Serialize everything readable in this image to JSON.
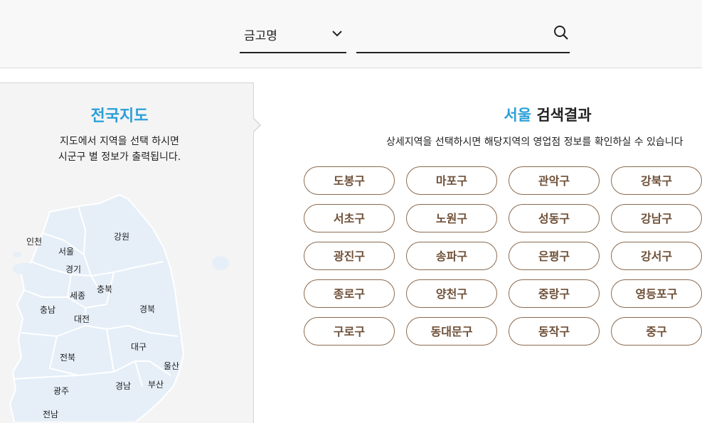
{
  "search": {
    "select_value": "금고명",
    "input_value": "",
    "input_placeholder": ""
  },
  "map_panel": {
    "title": "전국지도",
    "desc_line1": "지도에서 지역을 선택 하시면",
    "desc_line2": "시군구 별 정보가 출력됩니다.",
    "regions": {
      "incheon": "인천",
      "seoul": "서울",
      "gangwon": "강원",
      "gyeonggi": "경기",
      "sejong": "세종",
      "chungbuk": "충북",
      "chungnam": "충남",
      "daejeon": "대전",
      "gyeongbuk": "경북",
      "daegu": "대구",
      "jeonbuk": "전북",
      "ulsan": "울산",
      "gwangju": "광주",
      "gyeongnam": "경남",
      "busan": "부산",
      "jeonnam": "전남"
    }
  },
  "results": {
    "city": "서울",
    "title_suffix": "검색결과",
    "desc": "상세지역을 선택하시면 해당지역의 영업점 정보를 확인하실 수 있습니다",
    "districts": [
      "도봉구",
      "마포구",
      "관악구",
      "강북구",
      "서초구",
      "노원구",
      "성동구",
      "강남구",
      "광진구",
      "송파구",
      "은평구",
      "강서구",
      "종로구",
      "양천구",
      "중랑구",
      "영등포구",
      "구로구",
      "동대문구",
      "동작구",
      "중구"
    ]
  },
  "colors": {
    "accent": "#2b9fd8",
    "button_text": "#6e5038",
    "button_border": "#8a6a4f"
  }
}
